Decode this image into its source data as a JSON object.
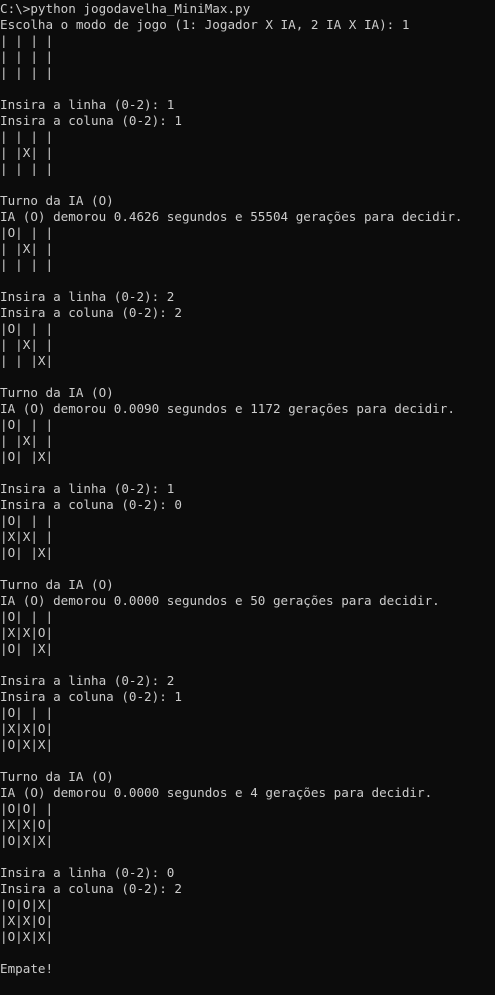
{
  "terminal": {
    "lines": [
      "C:\\>python jogodavelha_MiniMax.py",
      "Escolha o modo de jogo (1: Jogador X IA, 2 IA X IA): 1",
      "| | | |",
      "| | | |",
      "| | | |",
      "",
      "Insira a linha (0-2): 1",
      "Insira a coluna (0-2): 1",
      "| | | |",
      "| |X| |",
      "| | | |",
      "",
      "Turno da IA (O)",
      "IA (O) demorou 0.4626 segundos e 55504 gerações para decidir.",
      "|O| | |",
      "| |X| |",
      "| | | |",
      "",
      "Insira a linha (0-2): 2",
      "Insira a coluna (0-2): 2",
      "|O| | |",
      "| |X| |",
      "| | |X|",
      "",
      "Turno da IA (O)",
      "IA (O) demorou 0.0090 segundos e 1172 gerações para decidir.",
      "|O| | |",
      "| |X| |",
      "|O| |X|",
      "",
      "Insira a linha (0-2): 1",
      "Insira a coluna (0-2): 0",
      "|O| | |",
      "|X|X| |",
      "|O| |X|",
      "",
      "Turno da IA (O)",
      "IA (O) demorou 0.0000 segundos e 50 gerações para decidir.",
      "|O| | |",
      "|X|X|O|",
      "|O| |X|",
      "",
      "Insira a linha (0-2): 2",
      "Insira a coluna (0-2): 1",
      "|O| | |",
      "|X|X|O|",
      "|O|X|X|",
      "",
      "Turno da IA (O)",
      "IA (O) demorou 0.0000 segundos e 4 gerações para decidir.",
      "|O|O| |",
      "|X|X|O|",
      "|O|X|X|",
      "",
      "Insira a linha (0-2): 0",
      "Insira a coluna (0-2): 2",
      "|O|O|X|",
      "|X|X|O|",
      "|O|X|X|",
      "",
      "Empate!"
    ]
  },
  "colors": {
    "background": "#0c0c0c",
    "text": "#cccccc"
  }
}
